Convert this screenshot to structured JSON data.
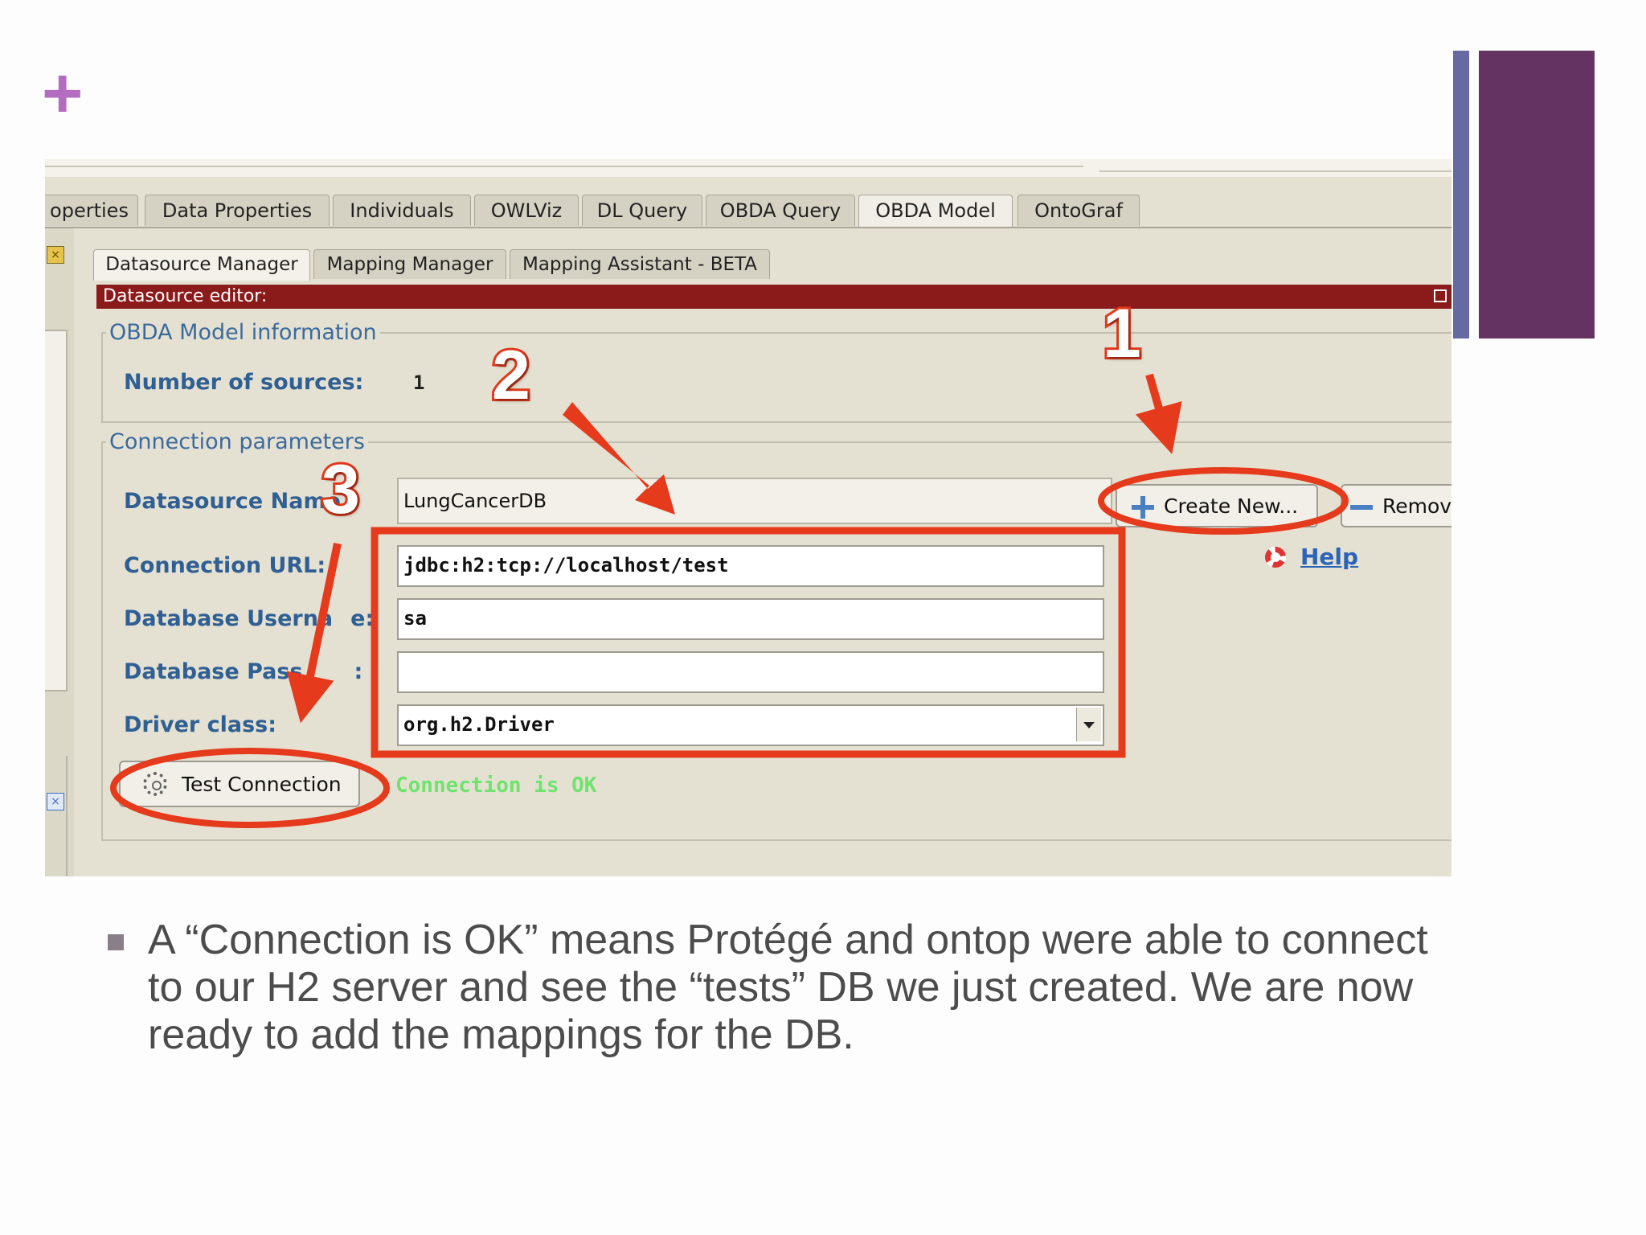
{
  "slide": {
    "bullet_text": "A “Connection is OK” means Protégé and ontop were able to connect to our H2 server and see the “tests” DB we just created. We are now ready to add the mappings for the DB."
  },
  "main_tabs": [
    "operties",
    "Data Properties",
    "Individuals",
    "OWLViz",
    "DL Query",
    "OBDA Query",
    "OBDA Model",
    "OntoGraf"
  ],
  "main_tab_active": "OBDA Model",
  "sub_tabs": [
    "Datasource Manager",
    "Mapping Manager",
    "Mapping Assistant - BETA"
  ],
  "sub_tab_active": "Datasource Manager",
  "editor": {
    "title": "Datasource editor:",
    "model_info": {
      "legend": "OBDA Model information",
      "sources_label": "Number of sources:",
      "sources_count": "1"
    },
    "connection": {
      "legend": "Connection parameters",
      "datasource_name_label": "Datasource Name",
      "datasource_name_value": "LungCancerDB",
      "url_label": "Connection URL:",
      "url_value": "jdbc:h2:tcp://localhost/test",
      "username_label": "Database Userna",
      "username_label_tail": "e:",
      "username_value": "sa",
      "password_label": "Database Pass",
      "password_label_tail": ":",
      "password_value": "",
      "driver_label": "Driver class:",
      "driver_value": "org.h2.Driver"
    },
    "buttons": {
      "create_new": "Create New...",
      "remove": "Remov",
      "help": "Help",
      "test_connection": "Test Connection"
    },
    "status": "Connection is OK"
  },
  "annotations": {
    "numbers": [
      "1",
      "2",
      "3"
    ],
    "color": "#e53a1c"
  },
  "colors": {
    "plus": "#b36cc0",
    "bar_thin": "#656aa3",
    "bar_thick": "#643361",
    "editor_bar": "#8b1a1a",
    "label_blue": "#2f5f93",
    "status_green": "#6ee36e"
  }
}
